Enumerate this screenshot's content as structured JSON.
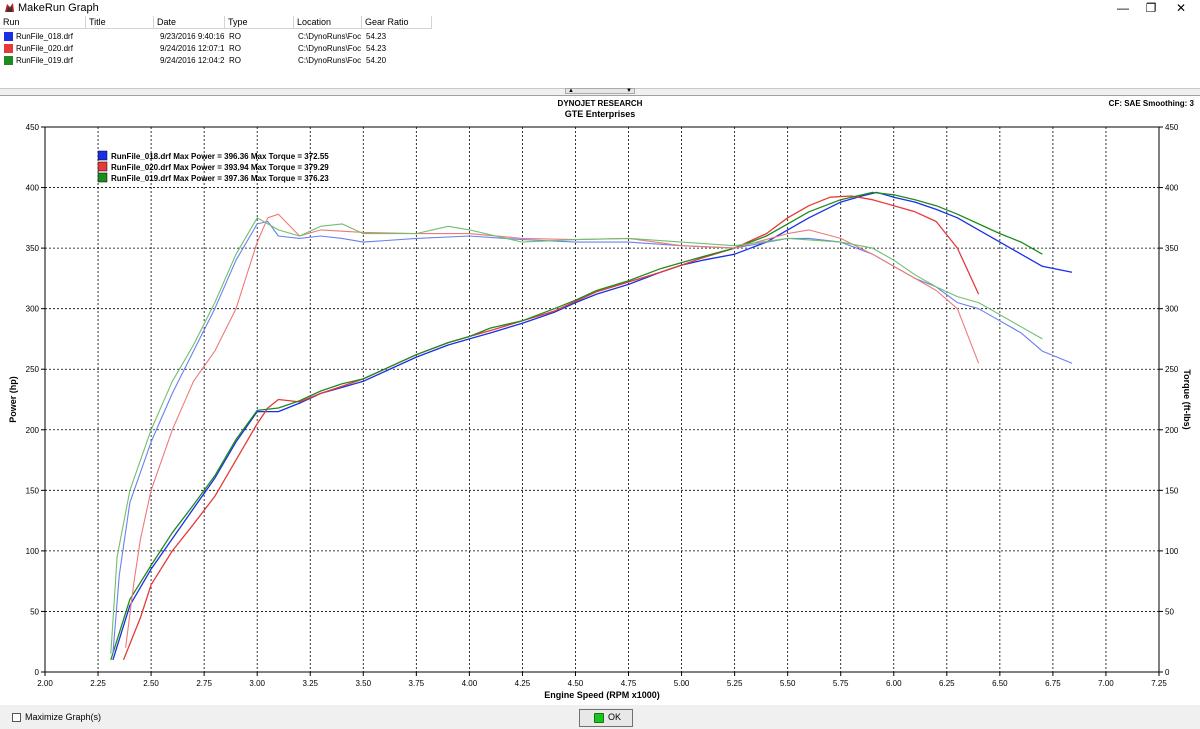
{
  "window": {
    "title": "MakeRun Graph",
    "minimize_glyph": "—",
    "restore_glyph": "❐",
    "close_glyph": "✕"
  },
  "run_table": {
    "headers": [
      "Run",
      "Title",
      "Date",
      "Type",
      "Location",
      "Gear Ratio"
    ],
    "rows": [
      {
        "run": "RunFile_018.drf",
        "title": "",
        "date": "9/23/2016 9:40:16",
        "type": "RO",
        "location": "C:\\DynoRuns\\Foc",
        "gear_ratio": "54.23",
        "color": "#1a2ee6"
      },
      {
        "run": "RunFile_020.drf",
        "title": "",
        "date": "9/24/2016 12:07:1",
        "type": "RO",
        "location": "C:\\DynoRuns\\Foc",
        "gear_ratio": "54.23",
        "color": "#e63a3a"
      },
      {
        "run": "RunFile_019.drf",
        "title": "",
        "date": "9/24/2016 12:04:2",
        "type": "RO",
        "location": "C:\\DynoRuns\\Foc",
        "gear_ratio": "54.20",
        "color": "#1f8a1f"
      }
    ]
  },
  "graph_header": {
    "line1": "DYNOJET RESEARCH",
    "line2": "GTE Enterprises",
    "cf_info": "CF: SAE  Smoothing: 3"
  },
  "bottom_bar": {
    "maximize_label": "Maximize Graph(s)",
    "ok_label": "OK"
  },
  "chart_data": {
    "type": "line",
    "title": "DYNOJET RESEARCH",
    "subtitle": "GTE Enterprises",
    "xlabel": "Engine Speed (RPM x1000)",
    "ylabel": "Power (hp)",
    "ylabel_right": "Torque (ft-lbs)",
    "xlim": [
      2.0,
      7.25
    ],
    "ylim": [
      0,
      450
    ],
    "ylim_right": [
      0,
      450
    ],
    "x_ticks": [
      "2.00",
      "2.25",
      "2.50",
      "2.75",
      "3.00",
      "3.25",
      "3.50",
      "3.75",
      "4.00",
      "4.25",
      "4.50",
      "4.75",
      "5.00",
      "5.25",
      "5.50",
      "5.75",
      "6.00",
      "6.25",
      "6.50",
      "6.75",
      "7.00",
      "7.25"
    ],
    "y_ticks": [
      "0",
      "50",
      "100",
      "150",
      "200",
      "250",
      "300",
      "350",
      "400",
      "450"
    ],
    "grid": true,
    "legend_placement": "top-left",
    "legend": [
      {
        "run": "RunFile_018.drf",
        "text": "RunFile_018.drf Max Power = 396.36 Max Torque = 372.55",
        "color": "#1a2ee6"
      },
      {
        "run": "RunFile_020.drf",
        "text": "RunFile_020.drf Max Power = 393.94 Max Torque = 379.29",
        "color": "#e63a3a"
      },
      {
        "run": "RunFile_019.drf",
        "text": "RunFile_019.drf Max Power = 397.36 Max Torque = 376.23",
        "color": "#1f8a1f"
      }
    ],
    "series": [
      {
        "run": "RunFile_018.drf",
        "quantity": "power",
        "color": "#1a2ee6",
        "style": "dark",
        "x": [
          2.32,
          2.4,
          2.5,
          2.6,
          2.7,
          2.8,
          2.9,
          3.0,
          3.1,
          3.2,
          3.3,
          3.4,
          3.5,
          3.6,
          3.75,
          3.9,
          4.0,
          4.1,
          4.25,
          4.4,
          4.5,
          4.6,
          4.75,
          4.9,
          5.0,
          5.1,
          5.25,
          5.4,
          5.5,
          5.6,
          5.75,
          5.85,
          5.92,
          6.0,
          6.1,
          6.2,
          6.3,
          6.4,
          6.5,
          6.6,
          6.7,
          6.84
        ],
        "y": [
          10,
          55,
          85,
          110,
          135,
          160,
          190,
          215,
          215,
          222,
          230,
          235,
          240,
          248,
          260,
          270,
          275,
          280,
          288,
          297,
          305,
          312,
          320,
          330,
          336,
          340,
          345,
          355,
          365,
          375,
          388,
          393,
          396,
          392,
          388,
          382,
          375,
          365,
          355,
          345,
          335,
          330
        ]
      },
      {
        "run": "RunFile_020.drf",
        "quantity": "power",
        "color": "#e63a3a",
        "style": "dark",
        "x": [
          2.37,
          2.45,
          2.5,
          2.6,
          2.7,
          2.8,
          2.9,
          3.0,
          3.05,
          3.1,
          3.2,
          3.3,
          3.4,
          3.5,
          3.6,
          3.75,
          3.9,
          4.0,
          4.1,
          4.25,
          4.4,
          4.5,
          4.6,
          4.75,
          4.9,
          5.0,
          5.1,
          5.25,
          5.4,
          5.5,
          5.6,
          5.7,
          5.8,
          5.9,
          6.0,
          6.1,
          6.2,
          6.3,
          6.4
        ],
        "y": [
          10,
          45,
          72,
          100,
          122,
          145,
          175,
          205,
          218,
          225,
          223,
          230,
          236,
          242,
          250,
          262,
          272,
          277,
          282,
          290,
          298,
          306,
          314,
          322,
          330,
          336,
          342,
          350,
          362,
          375,
          385,
          392,
          393,
          390,
          385,
          380,
          372,
          350,
          312
        ]
      },
      {
        "run": "RunFile_019.drf",
        "quantity": "power",
        "color": "#1f8a1f",
        "style": "dark",
        "x": [
          2.31,
          2.4,
          2.5,
          2.6,
          2.7,
          2.8,
          2.9,
          3.0,
          3.1,
          3.2,
          3.3,
          3.4,
          3.5,
          3.6,
          3.75,
          3.9,
          4.0,
          4.1,
          4.25,
          4.4,
          4.5,
          4.6,
          4.75,
          4.9,
          5.0,
          5.1,
          5.25,
          5.4,
          5.5,
          5.6,
          5.75,
          5.9,
          6.0,
          6.1,
          6.2,
          6.3,
          6.4,
          6.5,
          6.6,
          6.7
        ],
        "y": [
          10,
          60,
          88,
          115,
          138,
          162,
          192,
          216,
          218,
          224,
          232,
          238,
          242,
          250,
          262,
          272,
          277,
          284,
          290,
          300,
          307,
          315,
          323,
          333,
          338,
          343,
          350,
          360,
          370,
          380,
          390,
          396,
          394,
          390,
          385,
          378,
          370,
          362,
          355,
          345
        ]
      },
      {
        "run": "RunFile_018.drf",
        "quantity": "torque",
        "color": "#6b80ee",
        "style": "light",
        "x": [
          2.32,
          2.35,
          2.4,
          2.5,
          2.6,
          2.7,
          2.8,
          2.9,
          3.0,
          3.05,
          3.1,
          3.2,
          3.3,
          3.4,
          3.5,
          3.75,
          4.0,
          4.25,
          4.5,
          4.75,
          5.0,
          5.25,
          5.5,
          5.6,
          5.75,
          5.9,
          6.0,
          6.1,
          6.2,
          6.3,
          6.4,
          6.5,
          6.6,
          6.7,
          6.84
        ],
        "y": [
          15,
          80,
          140,
          190,
          230,
          265,
          300,
          340,
          370,
          372,
          360,
          358,
          360,
          358,
          355,
          358,
          360,
          357,
          355,
          355,
          352,
          350,
          358,
          358,
          355,
          345,
          335,
          325,
          318,
          305,
          300,
          290,
          280,
          265,
          255
        ]
      },
      {
        "run": "RunFile_020.drf",
        "quantity": "torque",
        "color": "#ee7a7a",
        "style": "light",
        "x": [
          2.38,
          2.42,
          2.45,
          2.5,
          2.6,
          2.7,
          2.8,
          2.9,
          3.0,
          3.05,
          3.1,
          3.2,
          3.3,
          3.5,
          3.75,
          4.0,
          4.25,
          4.5,
          4.75,
          5.0,
          5.25,
          5.5,
          5.6,
          5.75,
          5.9,
          6.0,
          6.1,
          6.2,
          6.3,
          6.4
        ],
        "y": [
          20,
          75,
          110,
          150,
          200,
          240,
          265,
          300,
          355,
          375,
          378,
          360,
          365,
          363,
          362,
          362,
          358,
          357,
          358,
          352,
          350,
          362,
          365,
          358,
          345,
          335,
          325,
          315,
          300,
          255
        ]
      },
      {
        "run": "RunFile_019.drf",
        "quantity": "torque",
        "color": "#6fbf6f",
        "style": "light",
        "x": [
          2.31,
          2.34,
          2.4,
          2.5,
          2.6,
          2.7,
          2.8,
          2.9,
          3.0,
          3.1,
          3.2,
          3.3,
          3.4,
          3.5,
          3.75,
          3.9,
          4.0,
          4.25,
          4.5,
          4.75,
          5.0,
          5.25,
          5.5,
          5.75,
          5.9,
          6.0,
          6.1,
          6.2,
          6.3,
          6.4,
          6.5,
          6.6,
          6.7
        ],
        "y": [
          15,
          95,
          150,
          200,
          240,
          270,
          305,
          345,
          375,
          365,
          360,
          368,
          370,
          362,
          362,
          368,
          365,
          355,
          357,
          358,
          355,
          352,
          358,
          355,
          350,
          340,
          328,
          318,
          310,
          305,
          295,
          285,
          275
        ]
      }
    ]
  }
}
